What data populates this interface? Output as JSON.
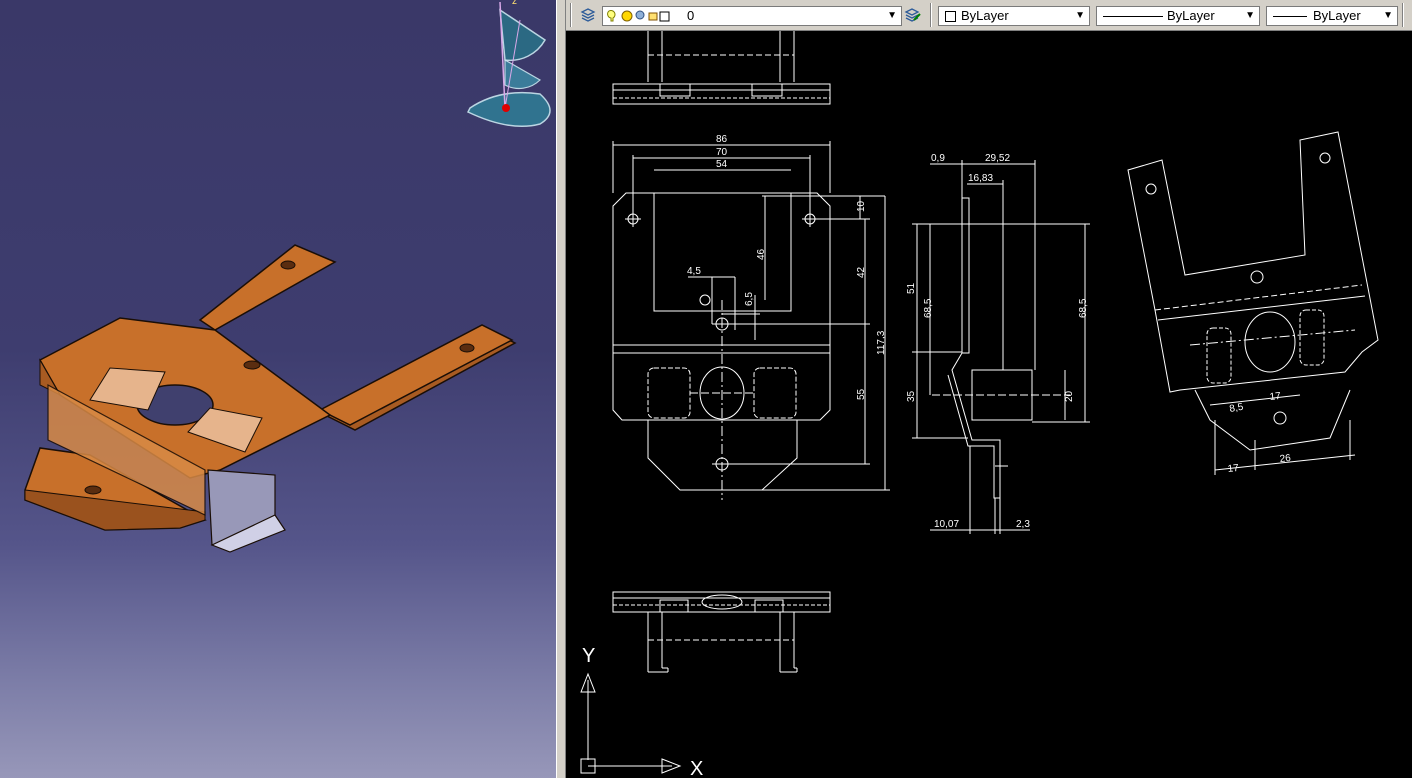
{
  "toolbar": {
    "layer_name": "0",
    "color": "ByLayer",
    "linetype": "ByLayer",
    "lineweight": "ByLayer"
  },
  "compass": {
    "z_label": "z"
  },
  "dimensions": {
    "front": [
      "86",
      "70",
      "54",
      "10",
      "46",
      "42",
      "4,5",
      "6,5",
      "117,3",
      "55"
    ],
    "side": [
      "0,9",
      "29,52",
      "16,83",
      "51",
      "68,5",
      "68,5",
      "35",
      "20",
      "10,07",
      "2,3"
    ],
    "iso": [
      "8,5",
      "17",
      "17",
      "26"
    ]
  },
  "ucs": {
    "x_label": "X",
    "y_label": "Y"
  },
  "colors": {
    "part": "#c8702a",
    "viewport": "#3a3868",
    "cad_background": "#000000",
    "toolbar": "#d4d0c8"
  }
}
